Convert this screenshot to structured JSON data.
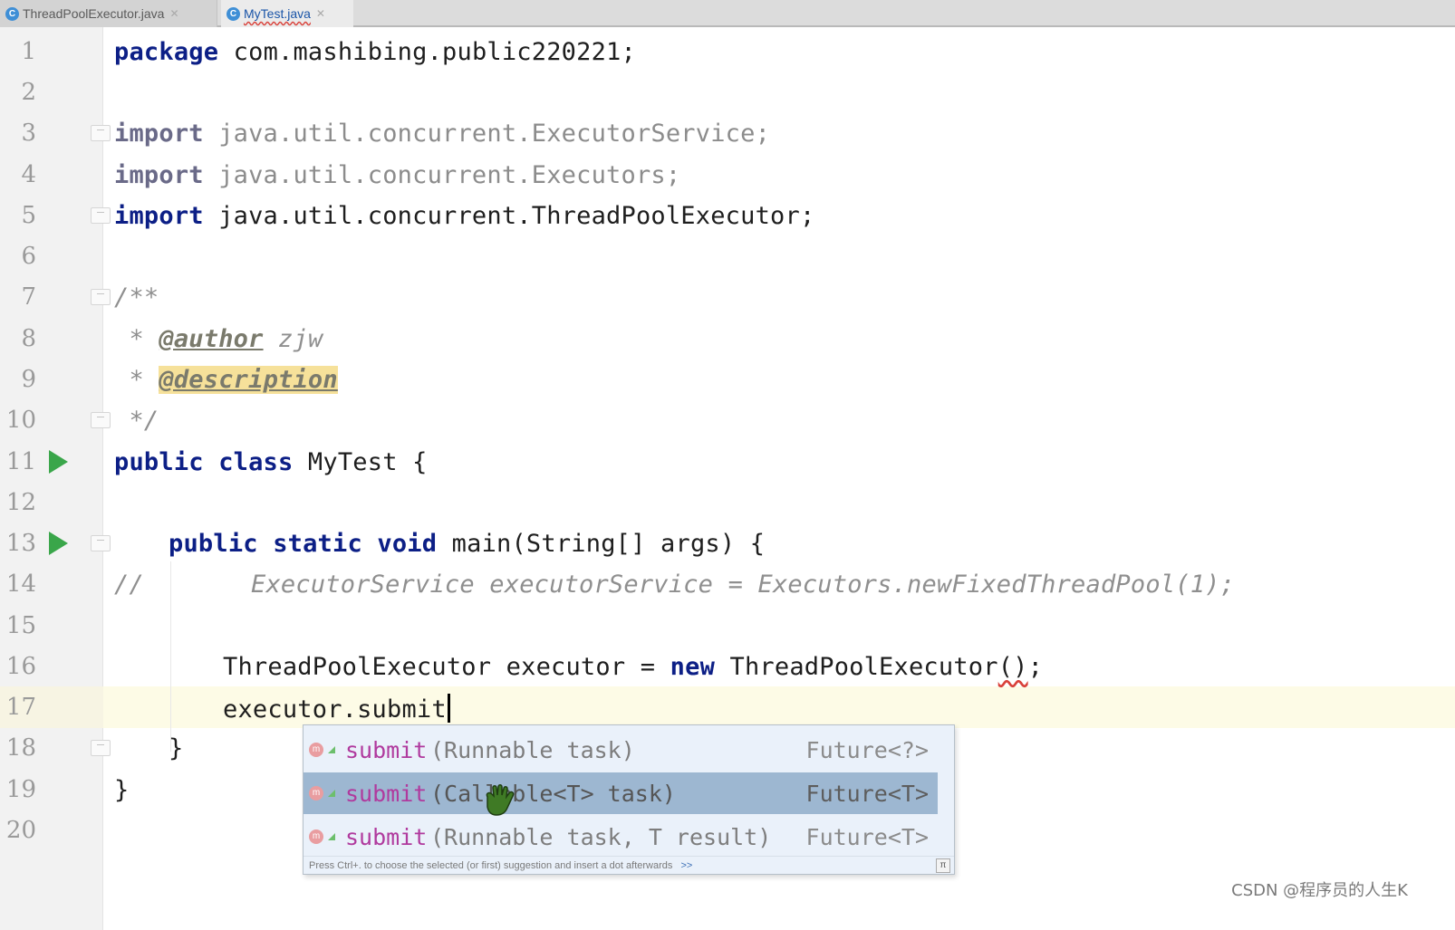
{
  "tabs": [
    {
      "label": "ThreadPoolExecutor.java",
      "icon": "class-icon",
      "active": false
    },
    {
      "label": "MyTest.java",
      "icon": "class-icon",
      "active": true
    }
  ],
  "editor": {
    "line_numbers": [
      "1",
      "2",
      "3",
      "4",
      "5",
      "6",
      "7",
      "8",
      "9",
      "10",
      "11",
      "12",
      "13",
      "14",
      "15",
      "16",
      "17",
      "18",
      "19",
      "20"
    ],
    "code": {
      "l1_kw": "package",
      "l1_rest": " com.mashibing.public220221;",
      "l3_kw": "import",
      "l3_rest": " java.util.concurrent.ExecutorService;",
      "l4_kw": "import",
      "l4_rest": " java.util.concurrent.Executors;",
      "l5_kw": "import",
      "l5_rest": " java.util.concurrent.ThreadPoolExecutor;",
      "l7": "/**",
      "l8_star": " * ",
      "l8_tag": "@author",
      "l8_rest": " zjw",
      "l9_star": " * ",
      "l9_tag": "@description",
      "l10": " */",
      "l11_kw": "public class",
      "l11_rest": " MyTest {",
      "l13_kw": "public static void",
      "l13_rest": " main(String[] args) {",
      "l14_slash": "//",
      "l14_rest": "ExecutorService executorService = Executors.newFixedThreadPool(1);",
      "l16_a": "ThreadPoolExecutor executor = ",
      "l16_kw": "new",
      "l16_b": " ThreadPoolExecutor",
      "l16_paren": "()",
      "l16_end": ";",
      "l17": "executor.submit",
      "l18": "}",
      "l19": "}"
    }
  },
  "completion": {
    "items": [
      {
        "name": "submit",
        "params": "(Runnable task)",
        "type": "Future<?>"
      },
      {
        "name": "submit",
        "params": "(Callable<T> task)",
        "type": "Future<T>"
      },
      {
        "name": "submit",
        "params": "(Runnable task, T result)",
        "type": "Future<T>"
      }
    ],
    "selected_index": 1,
    "footer": "Press Ctrl+. to choose the selected (or first) suggestion and insert a dot afterwards",
    "footer_more": ">>",
    "pi": "π"
  },
  "watermark": "CSDN @程序员的人生K",
  "colors": {
    "keyword": "#0c1f86",
    "comment": "#8f8f8f",
    "method": "#b03a9e",
    "run": "#3aa64a",
    "selection": "#9db7d1"
  }
}
